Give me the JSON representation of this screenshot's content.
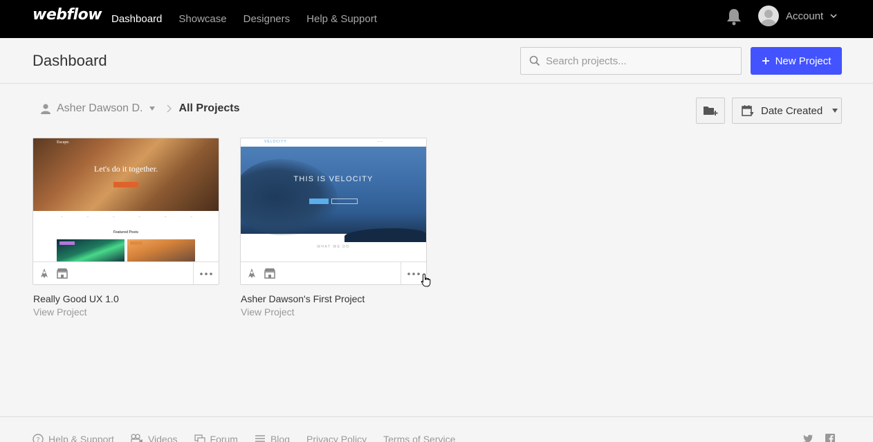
{
  "nav": {
    "logo": "webflow",
    "links": [
      "Dashboard",
      "Showcase",
      "Designers",
      "Help & Support"
    ],
    "account_label": "Account"
  },
  "header": {
    "title": "Dashboard",
    "search_placeholder": "Search projects...",
    "new_project_label": "New Project"
  },
  "breadcrumb": {
    "user": "Asher Dawson D.",
    "current": "All Projects"
  },
  "sort": {
    "label": "Date Created"
  },
  "projects": [
    {
      "name": "Really Good UX 1.0",
      "link": "View Project",
      "thumb": {
        "brand": "Escape.",
        "headline": "Let's do it together.",
        "section": "Featured Posts"
      }
    },
    {
      "name": "Asher Dawson's First Project",
      "link": "View Project",
      "thumb": {
        "brand": "VELOCITY",
        "headline": "THIS IS VELOCITY",
        "section": "WHAT WE DO"
      }
    }
  ],
  "footer": {
    "links": [
      "Help & Support",
      "Videos",
      "Forum",
      "Blog",
      "Privacy Policy",
      "Terms of Service"
    ]
  },
  "colors": {
    "accent": "#4353ff",
    "nav_bg": "#000000",
    "page_bg": "#f5f5f5"
  }
}
